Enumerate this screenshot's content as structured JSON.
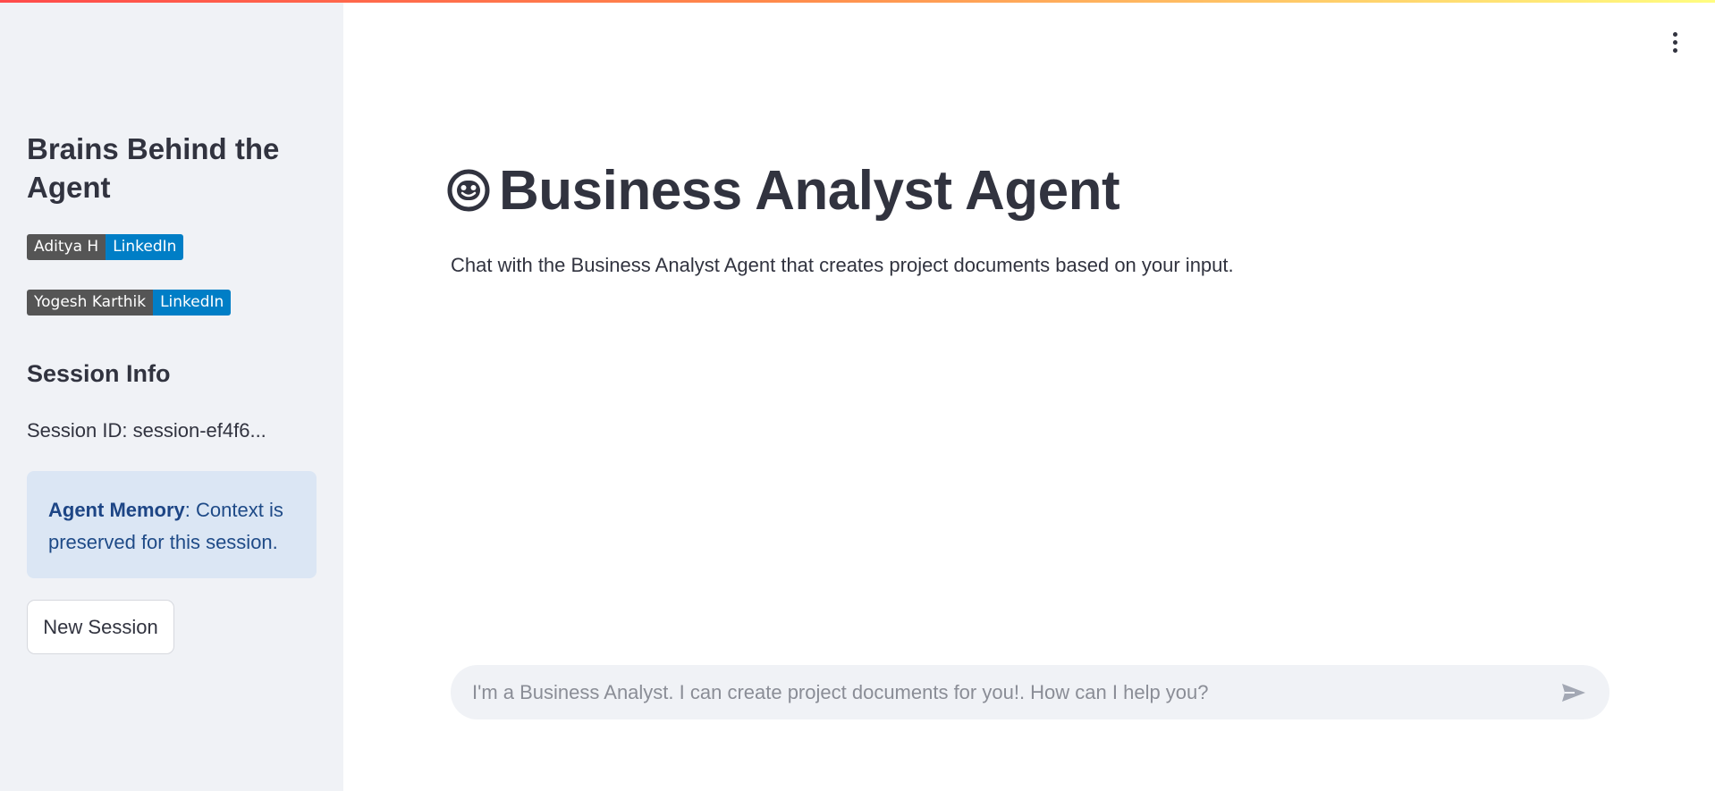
{
  "sidebar": {
    "title": "Brains Behind the Agent",
    "badges": [
      {
        "name": "Aditya H",
        "link": "LinkedIn"
      },
      {
        "name": "Yogesh Karthik",
        "link": "LinkedIn"
      }
    ],
    "session_heading": "Session Info",
    "session_id": "Session ID: session-ef4f6...",
    "info_box": {
      "bold": "Agent Memory",
      "text": ": Context is preserved for this session."
    },
    "new_session_label": "New Session"
  },
  "main": {
    "title": "Business Analyst Agent",
    "subtitle": "Chat with the Business Analyst Agent that creates project documents based on your input.",
    "chat_placeholder": "I'm a Business Analyst. I can create project documents for you!. How can I help you?"
  },
  "icons": {
    "title_icon": "robot-face-icon",
    "menu": "kebab-menu-icon",
    "send": "send-icon"
  },
  "colors": {
    "sidebar_bg": "#f0f2f6",
    "info_bg": "#dbe6f4",
    "info_text": "#1e4a87",
    "badge_name_bg": "#555555",
    "badge_link_bg": "#007ec6",
    "text": "#31333f"
  }
}
